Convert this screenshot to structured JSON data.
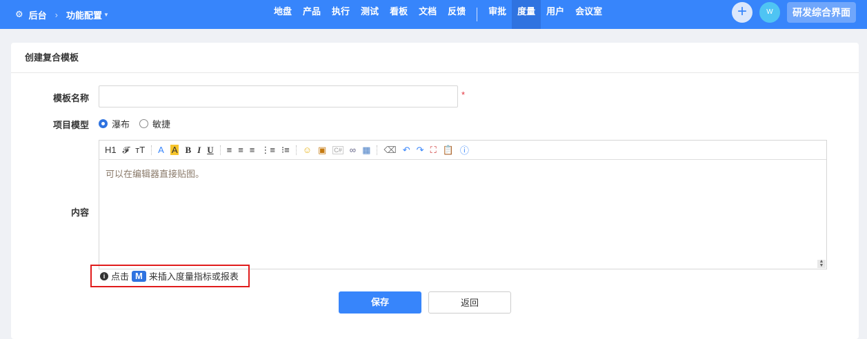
{
  "header": {
    "home": "后台",
    "section": "功能配置",
    "nav": [
      "地盘",
      "产品",
      "执行",
      "测试",
      "看板",
      "文档",
      "反馈"
    ],
    "nav2": [
      "审批",
      "度量",
      "用户",
      "会议室"
    ],
    "active": "度量",
    "avatar": "W",
    "workspace": "研发综合界面"
  },
  "form": {
    "title": "创建复合模板",
    "name_label": "模板名称",
    "name_value": "",
    "required": "*",
    "model_label": "项目模型",
    "options": [
      "瀑布",
      "敏捷"
    ],
    "content_label": "内容",
    "placeholder": "可以在编辑器直接贴图。",
    "toolbar": [
      "H1",
      "𝓕",
      "ᴛT",
      "A",
      "A",
      "B",
      "I",
      "U"
    ],
    "tip_prefix": "点击",
    "tip_key": "M",
    "tip_suffix": "来插入度量指标或报表",
    "save": "保存",
    "back": "返回"
  }
}
